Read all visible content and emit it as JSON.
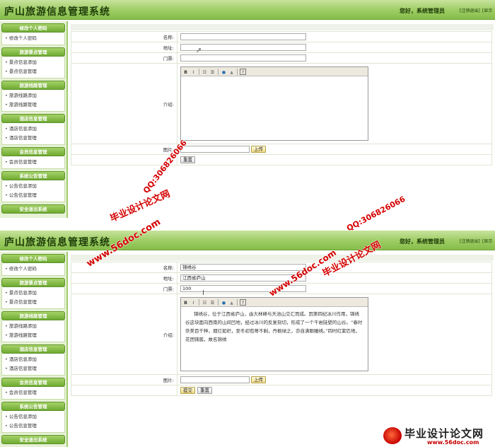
{
  "app_title": "庐山旅游信息管理系统",
  "greeting": "您好，系统管理员",
  "header_links": [
    "[注销退出]",
    "[显示"
  ],
  "sidebar": [
    {
      "title": "修改个人密码",
      "items": [
        "修改个人密码"
      ]
    },
    {
      "title": "旅游景点管理",
      "items": [
        "景点信息添加",
        "景点信息管理"
      ]
    },
    {
      "title": "旅游线路管理",
      "items": [
        "旅游线路添加",
        "旅游线路管理"
      ]
    },
    {
      "title": "酒店信息管理",
      "items": [
        "酒店信息添加",
        "酒店信息管理"
      ]
    },
    {
      "title": "会员信息管理",
      "items": [
        "会员信息管理"
      ]
    },
    {
      "title": "系统公告管理",
      "items": [
        "公告信息添加",
        "公告信息管理"
      ]
    },
    {
      "title": "安全退出系统",
      "items": []
    }
  ],
  "form": {
    "labels": {
      "name": "名称:",
      "address": "地址:",
      "ticket": "门票:",
      "intro": "介绍:",
      "image": "图片:"
    },
    "upload_label": "上传",
    "submit_label": "提交",
    "reset_label": "重置"
  },
  "panel_top": {
    "name": "",
    "address": "",
    "ticket": "",
    "intro": ""
  },
  "panel_bottom": {
    "name": "锦绣谷",
    "address": "江西省庐山",
    "ticket": "100",
    "intro": "锦绣谷，位于江西省庐山，由大林峰与天池山交汇而成。因第四纪冰川作用，锦绣谷这块面向西南的山间凹地，经过冰川的反复刻切，形成了一个千岩陡壁的山谷。“春时奈美百千种，烟烂如织，至冬初苞萼不剩，丹枫绿之，亦自满眼雕绣。”四时红紫匹地，花团锦簇，故名锦绣"
  },
  "editor_tools": [
    "B",
    "I",
    "☷",
    "☰",
    "●",
    "▲",
    "?"
  ],
  "watermarks": [
    "毕业设计论文网",
    "QQ:306826066",
    "www.56doc.com"
  ],
  "logo": {
    "text": "毕业设计论文网",
    "url": "www.56doc.com"
  }
}
